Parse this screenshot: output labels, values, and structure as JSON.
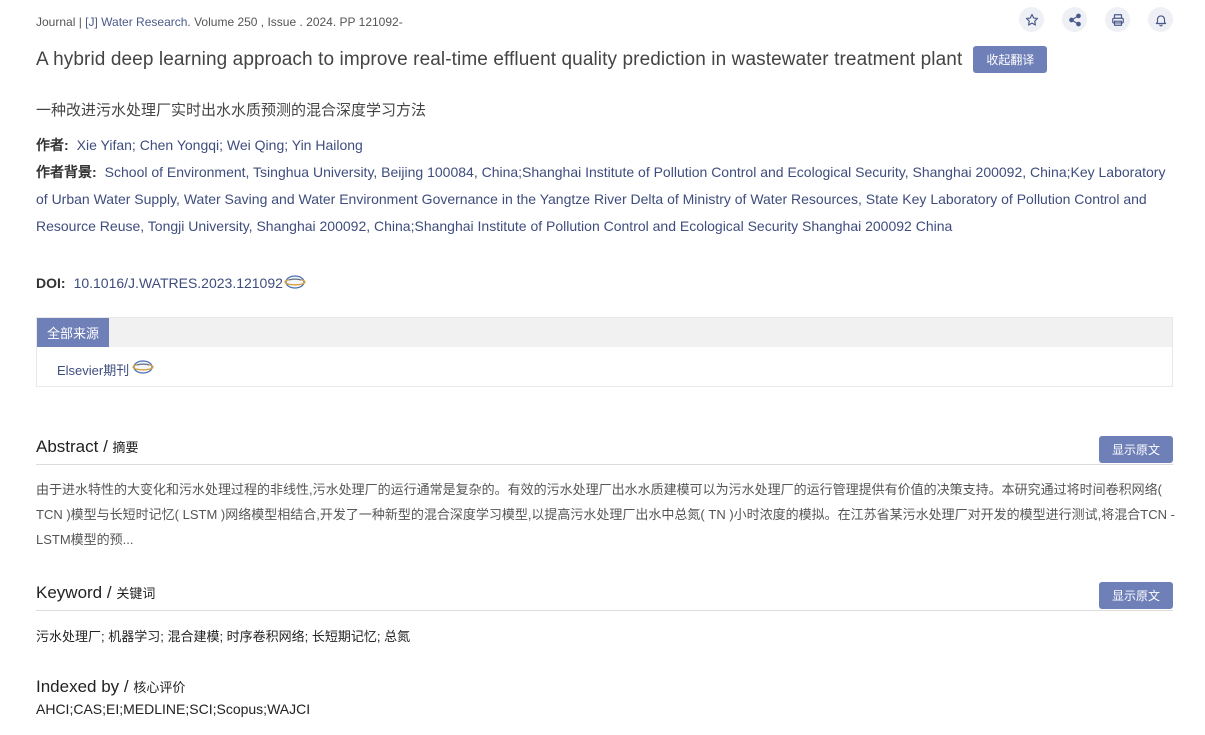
{
  "journal": {
    "prefix": "Journal | ",
    "name": "[J] Water Research",
    "details": ". Volume 250 , Issue . 2024. PP 121092-"
  },
  "toolbar": {
    "icons": [
      "star-icon",
      "share-icon",
      "print-icon",
      "bell-icon"
    ]
  },
  "article": {
    "title": "A hybrid deep learning approach to improve real-time effluent quality prediction in wastewater treatment plant",
    "collapse_translation_label": "收起翻译",
    "translated_title": "一种改进污水处理厂实时出水水质预测的混合深度学习方法",
    "authors_label": "作者:",
    "authors": "Xie Yifan; Chen Yongqi; Wei Qing; Yin Hailong",
    "affiliation_label": "作者背景:",
    "affiliation": "School of Environment, Tsinghua University, Beijing 100084, China;Shanghai Institute of Pollution Control and Ecological Security, Shanghai 200092, China;Key Laboratory of Urban Water Supply, Water Saving and Water Environment Governance in the Yangtze River Delta of Ministry of Water Resources, State Key Laboratory of Pollution Control and Resource Reuse, Tongji University, Shanghai 200092, China;Shanghai Institute of Pollution Control and Ecological Security Shanghai 200092 China",
    "doi_label": "DOI:",
    "doi": "10.1016/J.WATRES.2023.121092"
  },
  "sources": {
    "tab_label": "全部来源",
    "items": [
      {
        "label": "Elsevier期刊"
      }
    ]
  },
  "abstract": {
    "title": "Abstract / ",
    "title_cn": "摘要",
    "show_original_label": "显示原文",
    "text": "由于进水特性的大变化和污水处理过程的非线性,污水处理厂的运行通常是复杂的。有效的污水处理厂出水水质建模可以为污水处理厂的运行管理提供有价值的决策支持。本研究通过将时间卷积网络( TCN )模型与长短时记忆( LSTM )网络模型相结合,开发了一种新型的混合深度学习模型,以提高污水处理厂出水中总氮( TN )小时浓度的模拟。在江苏省某污水处理厂对开发的模型进行测试,将混合TCN - LSTM模型的预..."
  },
  "keyword": {
    "title": "Keyword / ",
    "title_cn": "关键词",
    "show_original_label": "显示原文",
    "text": "污水处理厂;  机器学习;  混合建模;  时序卷积网络;  长短期记忆;  总氮"
  },
  "indexed": {
    "title": "Indexed by / ",
    "title_cn": "核心评价",
    "values": "AHCI;CAS;EI;MEDLINE;SCI;Scopus;WAJCI"
  },
  "colors": {
    "accent": "#6f7fb8",
    "link": "#3f4d7e"
  }
}
